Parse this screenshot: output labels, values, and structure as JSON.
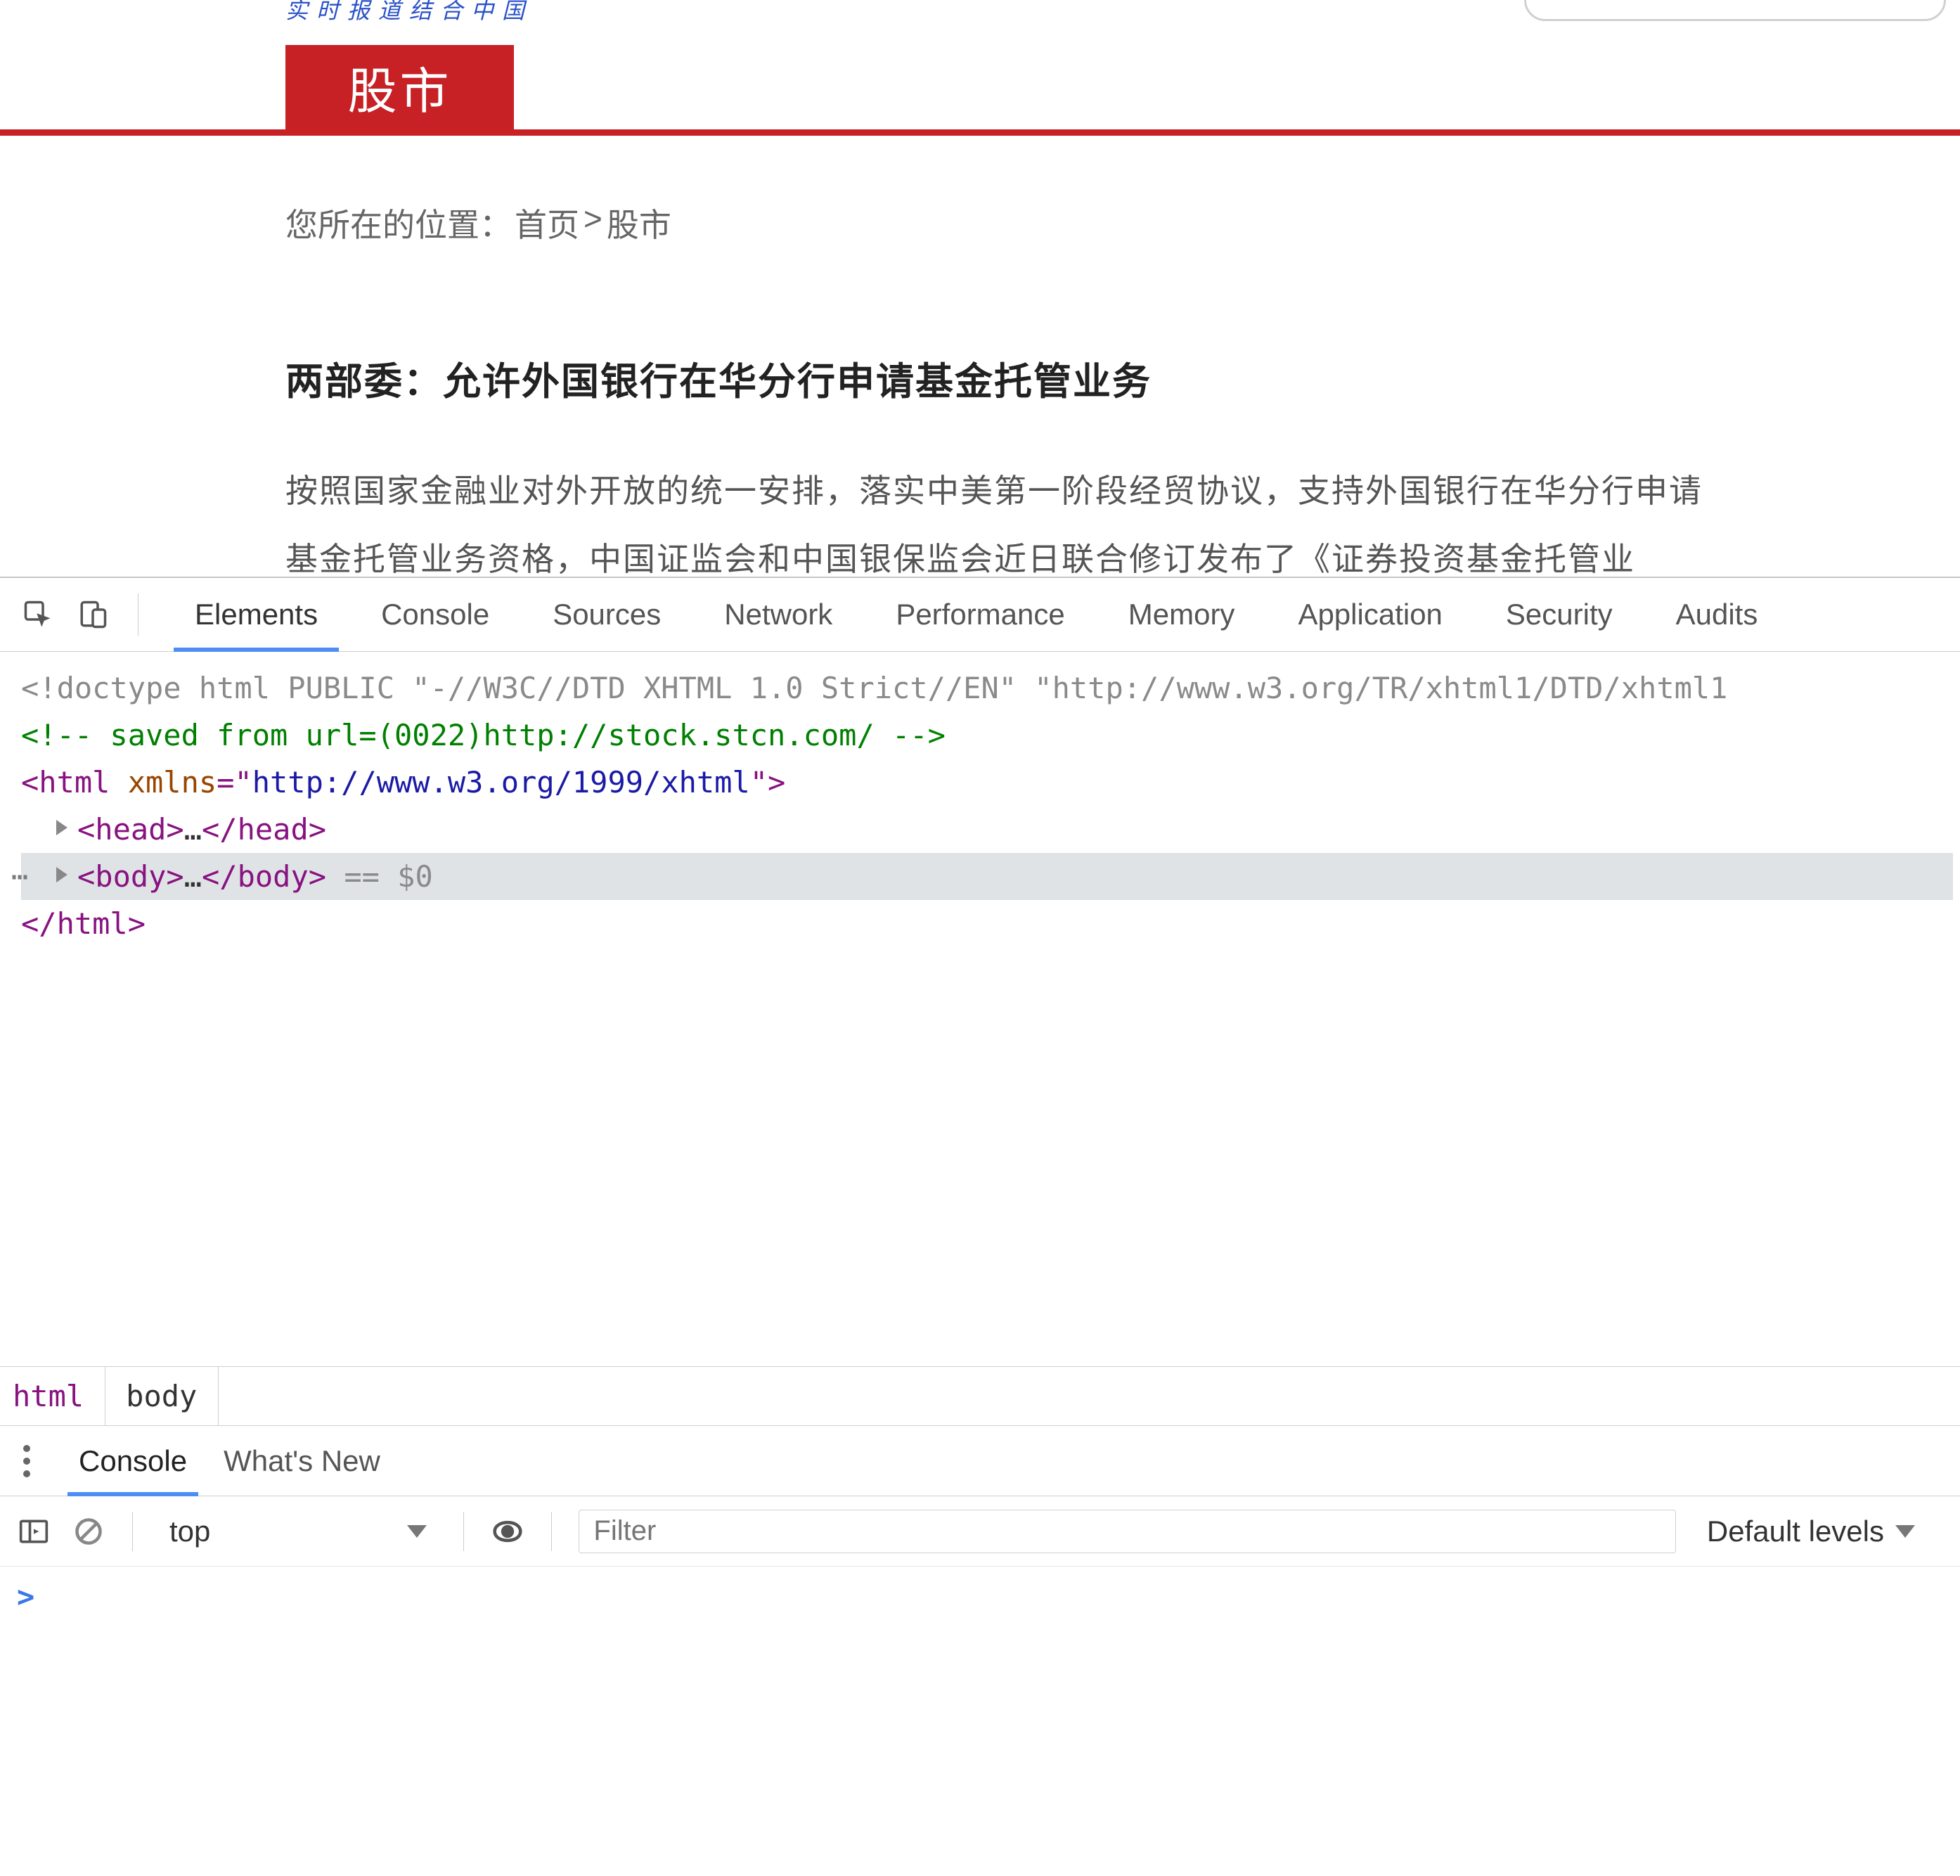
{
  "page": {
    "tagline": "实时报道结合中国",
    "section_tab": "股市",
    "breadcrumb": {
      "prefix": "您所在的位置：",
      "home": "首页",
      "sep": ">",
      "current": "股市"
    },
    "article": {
      "title": "两部委：允许外国银行在华分行申请基金托管业务",
      "line1": "按照国家金融业对外开放的统一安排，落实中美第一阶段经贸协议，支持外国银行在华分行申请",
      "line2": "基金托管业务资格，中国证监会和中国银保监会近日联合修订发布了《证券投资基金托管业"
    }
  },
  "devtools": {
    "tabs": [
      "Elements",
      "Console",
      "Sources",
      "Network",
      "Performance",
      "Memory",
      "Application",
      "Security",
      "Audits"
    ],
    "active_tab": "Elements",
    "dom": {
      "doctype": "<!doctype html PUBLIC \"-//W3C//DTD XHTML 1.0 Strict//EN\" \"http://www.w3.org/TR/xhtml1/DTD/xhtml1",
      "comment": "<!-- saved from url=(0022)http://stock.stcn.com/ -->",
      "html_open_pre": "<html ",
      "html_attr_name": "xmlns",
      "html_attr_eq": "=\"",
      "html_attr_val": "http://www.w3.org/1999/xhtml",
      "html_open_post": "\">",
      "head_open": "<head>",
      "ellipsis": "…",
      "head_close": "</head>",
      "body_open": "<body>",
      "body_close": "</body>",
      "sel_marker": " == $0",
      "html_close": "</html>"
    },
    "crumbs": [
      "html",
      "body"
    ],
    "drawer_tabs": [
      "Console",
      "What's New"
    ],
    "drawer_active": "Console",
    "console_toolbar": {
      "context": "top",
      "filter_placeholder": "Filter",
      "levels": "Default levels"
    },
    "console_prompt": ">"
  }
}
